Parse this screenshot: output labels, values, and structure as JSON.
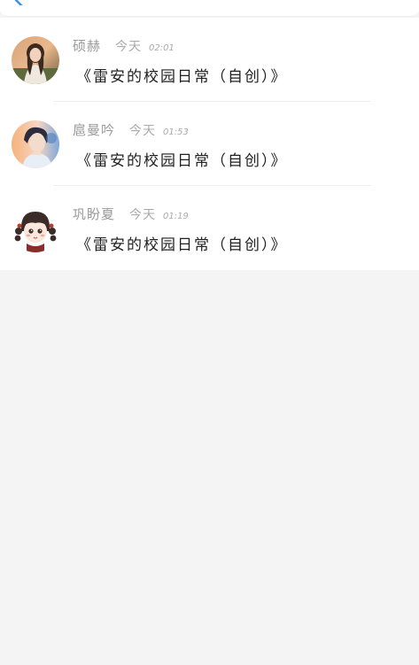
{
  "colors": {
    "background": "#f4f4f4",
    "card": "#ffffff",
    "accent": "#3a8ef6",
    "name_text": "#9a9a9a",
    "title_text": "#1f1f1f"
  },
  "header": {
    "back_icon": "back-arrow-icon"
  },
  "list": {
    "items": [
      {
        "name": "硕赫",
        "day": "今天",
        "time": "02:01",
        "title": "《雷安的校园日常（自创）》",
        "avatar": "girl-photo-avatar"
      },
      {
        "name": "扈曼吟",
        "day": "今天",
        "time": "01:53",
        "title": "《雷安的校园日常（自创）》",
        "avatar": "boy-photo-avatar"
      },
      {
        "name": "巩盼夏",
        "day": "今天",
        "time": "01:19",
        "title": "《雷安的校园日常（自创）》",
        "avatar": "anime-girl-avatar"
      }
    ]
  }
}
